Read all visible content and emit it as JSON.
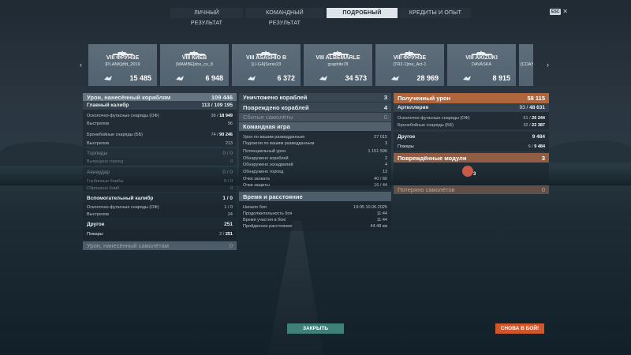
{
  "tabs": [
    {
      "label": "ЛИЧНЫЙ РЕЗУЛЬТАТ",
      "active": false
    },
    {
      "label": "КОМАНДНЫЙ РЕЗУЛЬТАТ",
      "active": false
    },
    {
      "label": "ПОДРОБНЫЙ ОТЧЁТ",
      "active": true
    },
    {
      "label": "КРЕДИТЫ И ОПЫТ",
      "active": false
    }
  ],
  "esc": {
    "badge": "ESC",
    "close": "✕"
  },
  "cards": [
    {
      "ship": "VIII ФРУНЗЕ",
      "player": "[PLANK]dfd_2019",
      "damage": "15 485"
    },
    {
      "ship": "VIII КИЕВ",
      "player": "[MAMBE]dox_cv_8",
      "damage": "6 948"
    },
    {
      "ship": "VIII ASASHIO B",
      "player": "[LI-GA]Sonix23",
      "damage": "6 372"
    },
    {
      "ship": "VIII ALBEMARLE",
      "player": "graphite78",
      "damage": "34 573"
    },
    {
      "ship": "VIII ФРУНЗЕ",
      "player": "[TR2-1]me_Act-1",
      "damage": "28 969"
    },
    {
      "ship": "VIII AKIZUKI",
      "player": "DAVASKA",
      "damage": "8 915"
    },
    {
      "ship": "",
      "player": "[COAST]",
      "damage": ""
    }
  ],
  "nav": {
    "prev": "‹",
    "next": "›"
  },
  "col1": {
    "dealt": {
      "label": "Урон, нанесённый кораблям",
      "value": "109 446"
    },
    "main": {
      "label": "Главный калибр",
      "hits": "113",
      "shots": "109 195"
    },
    "main_rows": [
      {
        "label": "Осколочно-фугасные снаряды (ОФ)",
        "value": "39 / ",
        "bold": "18 949"
      },
      {
        "label": "Выстрелов",
        "value": "96",
        "bold": ""
      },
      {
        "label": "Бронебойные снаряды (ББ)",
        "value": "74 / ",
        "bold": "90 246"
      },
      {
        "label": "Выстрелов",
        "value": "213",
        "bold": ""
      }
    ],
    "torpedo": {
      "label": "Торпеды",
      "value": "0 / 0"
    },
    "torpedo_rows": [
      {
        "label": "Выпущено торпед",
        "value": "0"
      }
    ],
    "air": {
      "label": "Авиаудар",
      "value": "0 / 0"
    },
    "air_rows": [
      {
        "label": "Глубинные бомбы",
        "value": "0 / 0"
      },
      {
        "label": "Сброшено бомб",
        "value": "0"
      }
    ],
    "secondary": {
      "label": "Вспомогательный калибр",
      "value": "1 / 0"
    },
    "secondary_rows": [
      {
        "label": "Осколочно-фугасные снаряды (ОФ)",
        "value": "1 / 0"
      },
      {
        "label": "Выстрелов",
        "value": "24"
      }
    ],
    "other": {
      "label": "Другое",
      "value": "251"
    },
    "other_rows": [
      {
        "label": "Пожары",
        "value": "2 / ",
        "bold": "251"
      }
    ],
    "planes_dmg": {
      "label": "Урон, нанесённый самолётам",
      "value": "0"
    }
  },
  "col2": {
    "destroyed": {
      "label": "Уничтожено кораблей",
      "value": "3"
    },
    "damaged": {
      "label": "Повреждено кораблей",
      "value": "4"
    },
    "planes": {
      "label": "Сбитые самолёты",
      "value": "0"
    },
    "team": {
      "label": "Командная игра"
    },
    "team_rows": [
      {
        "label": "Урон по вашим разведданным",
        "value": "27 015"
      },
      {
        "label": "Подожгли по вашим разведданным",
        "value": "3"
      },
      {
        "label": "Потенциальный урон",
        "value": "1 151 596"
      },
      {
        "label": "Обнаружено кораблей",
        "value": "2"
      },
      {
        "label": "Обнаружено эскадрилий",
        "value": "4"
      },
      {
        "label": "Обнаружено торпед",
        "value": "13"
      },
      {
        "label": "Очки захвата",
        "value": "40 / 80"
      },
      {
        "label": "Очки защиты",
        "value": "16 / 44"
      }
    ],
    "time": {
      "label": "Время и расстояние"
    },
    "time_rows": [
      {
        "label": "Начало боя",
        "value": "19:05  10.06.2025"
      },
      {
        "label": "Продолжительность боя",
        "value": "11:44"
      },
      {
        "label": "Время участия в бою",
        "value": "11:44"
      },
      {
        "label": "Пройденное расстояние",
        "value": "44.48 км"
      }
    ]
  },
  "col3": {
    "received": {
      "label": "Полученный урон",
      "value": "58 115"
    },
    "artillery": {
      "label": "Артиллерия",
      "hits": "93 / ",
      "bold": "48 631"
    },
    "artillery_rows": [
      {
        "label": "Осколочно-фугасные снаряды (ОФ)",
        "value": "61 / ",
        "bold": "26 244"
      },
      {
        "label": "Бронебойные снаряды (ББ)",
        "value": "32 / ",
        "bold": "22 387"
      }
    ],
    "other": {
      "label": "Другое",
      "value": "9 484"
    },
    "other_rows": [
      {
        "label": "Пожары",
        "value": "6 / ",
        "bold": "9 484"
      }
    ],
    "modules": {
      "label": "Повреждённые модули",
      "value": "3",
      "count": "3"
    },
    "planes_lost": {
      "label": "Потеряно самолётов",
      "value": "0"
    }
  },
  "buttons": {
    "close": "ЗАКРЫТЬ",
    "battle": "СНОВА В БОЙ!"
  },
  "colors": {
    "accent": "#d0562c",
    "teal": "#3f8178",
    "header_orange": "#c86e3c"
  }
}
